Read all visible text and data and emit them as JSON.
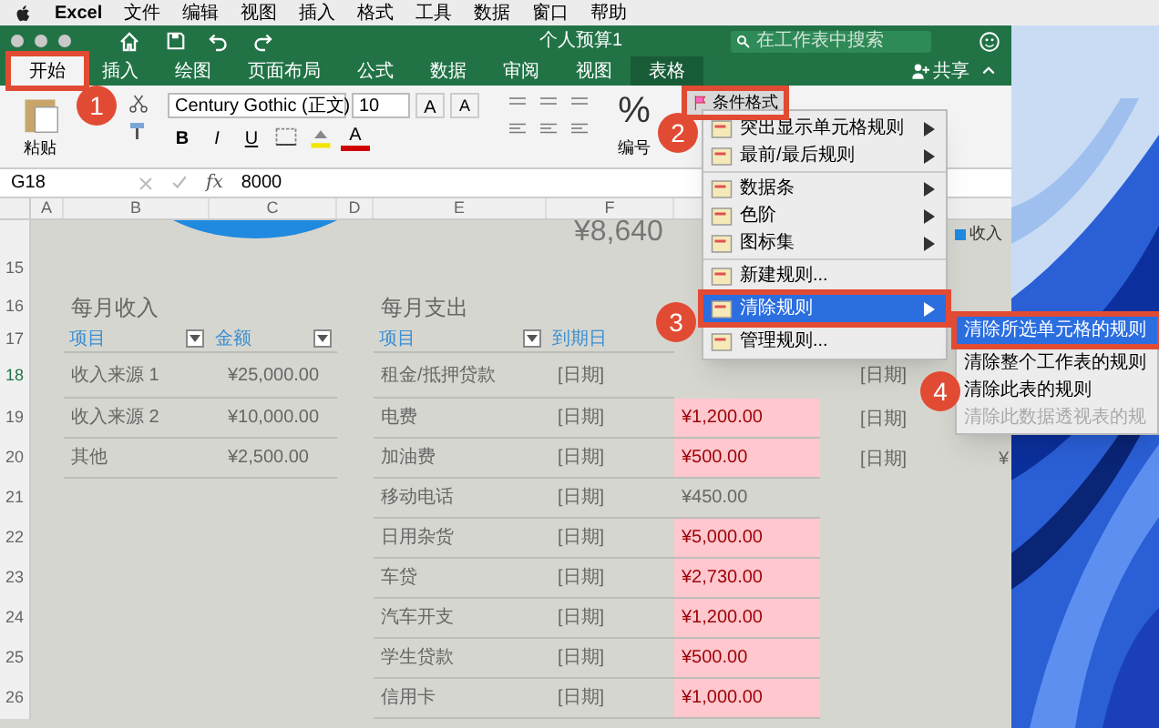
{
  "menubar": {
    "app": "Excel",
    "items": [
      "文件",
      "编辑",
      "视图",
      "插入",
      "格式",
      "工具",
      "数据",
      "窗口",
      "帮助"
    ]
  },
  "window": {
    "title": "个人预算1",
    "search": {
      "placeholder": "在工作表中搜索"
    }
  },
  "tabs": [
    {
      "label": "开始",
      "selected": true,
      "kind": "standard"
    },
    {
      "label": "插入",
      "selected": false,
      "kind": "standard"
    },
    {
      "label": "绘图",
      "selected": false,
      "kind": "standard"
    },
    {
      "label": "页面布局",
      "selected": false,
      "kind": "standard"
    },
    {
      "label": "公式",
      "selected": false,
      "kind": "standard"
    },
    {
      "label": "数据",
      "selected": false,
      "kind": "standard"
    },
    {
      "label": "审阅",
      "selected": false,
      "kind": "standard"
    },
    {
      "label": "视图",
      "selected": false,
      "kind": "standard"
    },
    {
      "label": "表格",
      "selected": false,
      "kind": "context"
    }
  ],
  "share": "共享",
  "ribbon": {
    "paste": "粘贴",
    "font": "Century Gothic (正文)",
    "size": "10",
    "grow": "A",
    "shrink": "A",
    "bold": "B",
    "italic": "I",
    "underline": "U",
    "font_color": "A",
    "percent": "%",
    "number": "编号",
    "conditional_format": "条件格式"
  },
  "formula_bar": {
    "cell": "G18",
    "fx": "fx",
    "value": "8000"
  },
  "columns": [
    "A",
    "B",
    "C",
    "D",
    "E",
    "F"
  ],
  "summary_value": "¥8,640",
  "legend": "收入",
  "row_numbers": [
    "15",
    "16",
    "17",
    "18",
    "19",
    "20",
    "21",
    "22",
    "23",
    "24",
    "25",
    "26"
  ],
  "income": {
    "title": "每月收入",
    "columns": [
      "项目",
      "金额"
    ],
    "rows": [
      {
        "item": "收入来源 1",
        "amount": "¥25,000.00"
      },
      {
        "item": "收入来源 2",
        "amount": "¥10,000.00"
      },
      {
        "item": "其他",
        "amount": "¥2,500.00"
      }
    ]
  },
  "expenses": {
    "title": "每月支出",
    "columns": [
      "项目",
      "到期日"
    ],
    "rows": [
      {
        "item": "租金/抵押贷款",
        "due": "[日期]"
      },
      {
        "item": "电费",
        "due": "[日期]",
        "amount": "¥1,200.00",
        "highlighted": true
      },
      {
        "item": "加油费",
        "due": "[日期]",
        "amount": "¥500.00",
        "highlighted": true
      },
      {
        "item": "移动电话",
        "due": "[日期]",
        "amount": "¥450.00",
        "highlighted": false
      },
      {
        "item": "日用杂货",
        "due": "[日期]",
        "amount": "¥5,000.00",
        "highlighted": true
      },
      {
        "item": "车贷",
        "due": "[日期]",
        "amount": "¥2,730.00",
        "highlighted": true
      },
      {
        "item": "汽车开支",
        "due": "[日期]",
        "amount": "¥1,200.00",
        "highlighted": true
      },
      {
        "item": "学生贷款",
        "due": "[日期]",
        "amount": "¥500.00",
        "highlighted": true
      },
      {
        "item": "信用卡",
        "due": "[日期]",
        "amount": "¥1,000.00",
        "highlighted": true
      }
    ]
  },
  "column_h": [
    "[日期]",
    "[日期]",
    "[日期]"
  ],
  "column_i_row20": "¥",
  "menu": {
    "groups": [
      [
        {
          "label": "突出显示单元格规则",
          "selected": false,
          "has_submenu": true
        },
        {
          "label": "最前/最后规则",
          "selected": false,
          "has_submenu": true
        }
      ],
      [
        {
          "label": "数据条",
          "selected": false,
          "has_submenu": true
        },
        {
          "label": "色阶",
          "selected": false,
          "has_submenu": true
        },
        {
          "label": "图标集",
          "selected": false,
          "has_submenu": true
        }
      ],
      [
        {
          "label": "新建规则...",
          "selected": false,
          "has_submenu": false
        },
        {
          "label": "清除规则",
          "selected": true,
          "has_submenu": true
        },
        {
          "label": "管理规则...",
          "selected": false,
          "has_submenu": false
        }
      ]
    ]
  },
  "submenu": [
    {
      "label": "清除所选单元格的规则",
      "selected": true,
      "disabled": false
    },
    {
      "label": "清除整个工作表的规则",
      "selected": false,
      "disabled": false
    },
    {
      "label": "清除此表的规则",
      "selected": false,
      "disabled": false
    },
    {
      "label": "清除此数据透视表的规",
      "selected": false,
      "disabled": true
    }
  ],
  "annotations": [
    {
      "label": "1"
    },
    {
      "label": "2"
    },
    {
      "label": "3"
    },
    {
      "label": "4"
    }
  ]
}
